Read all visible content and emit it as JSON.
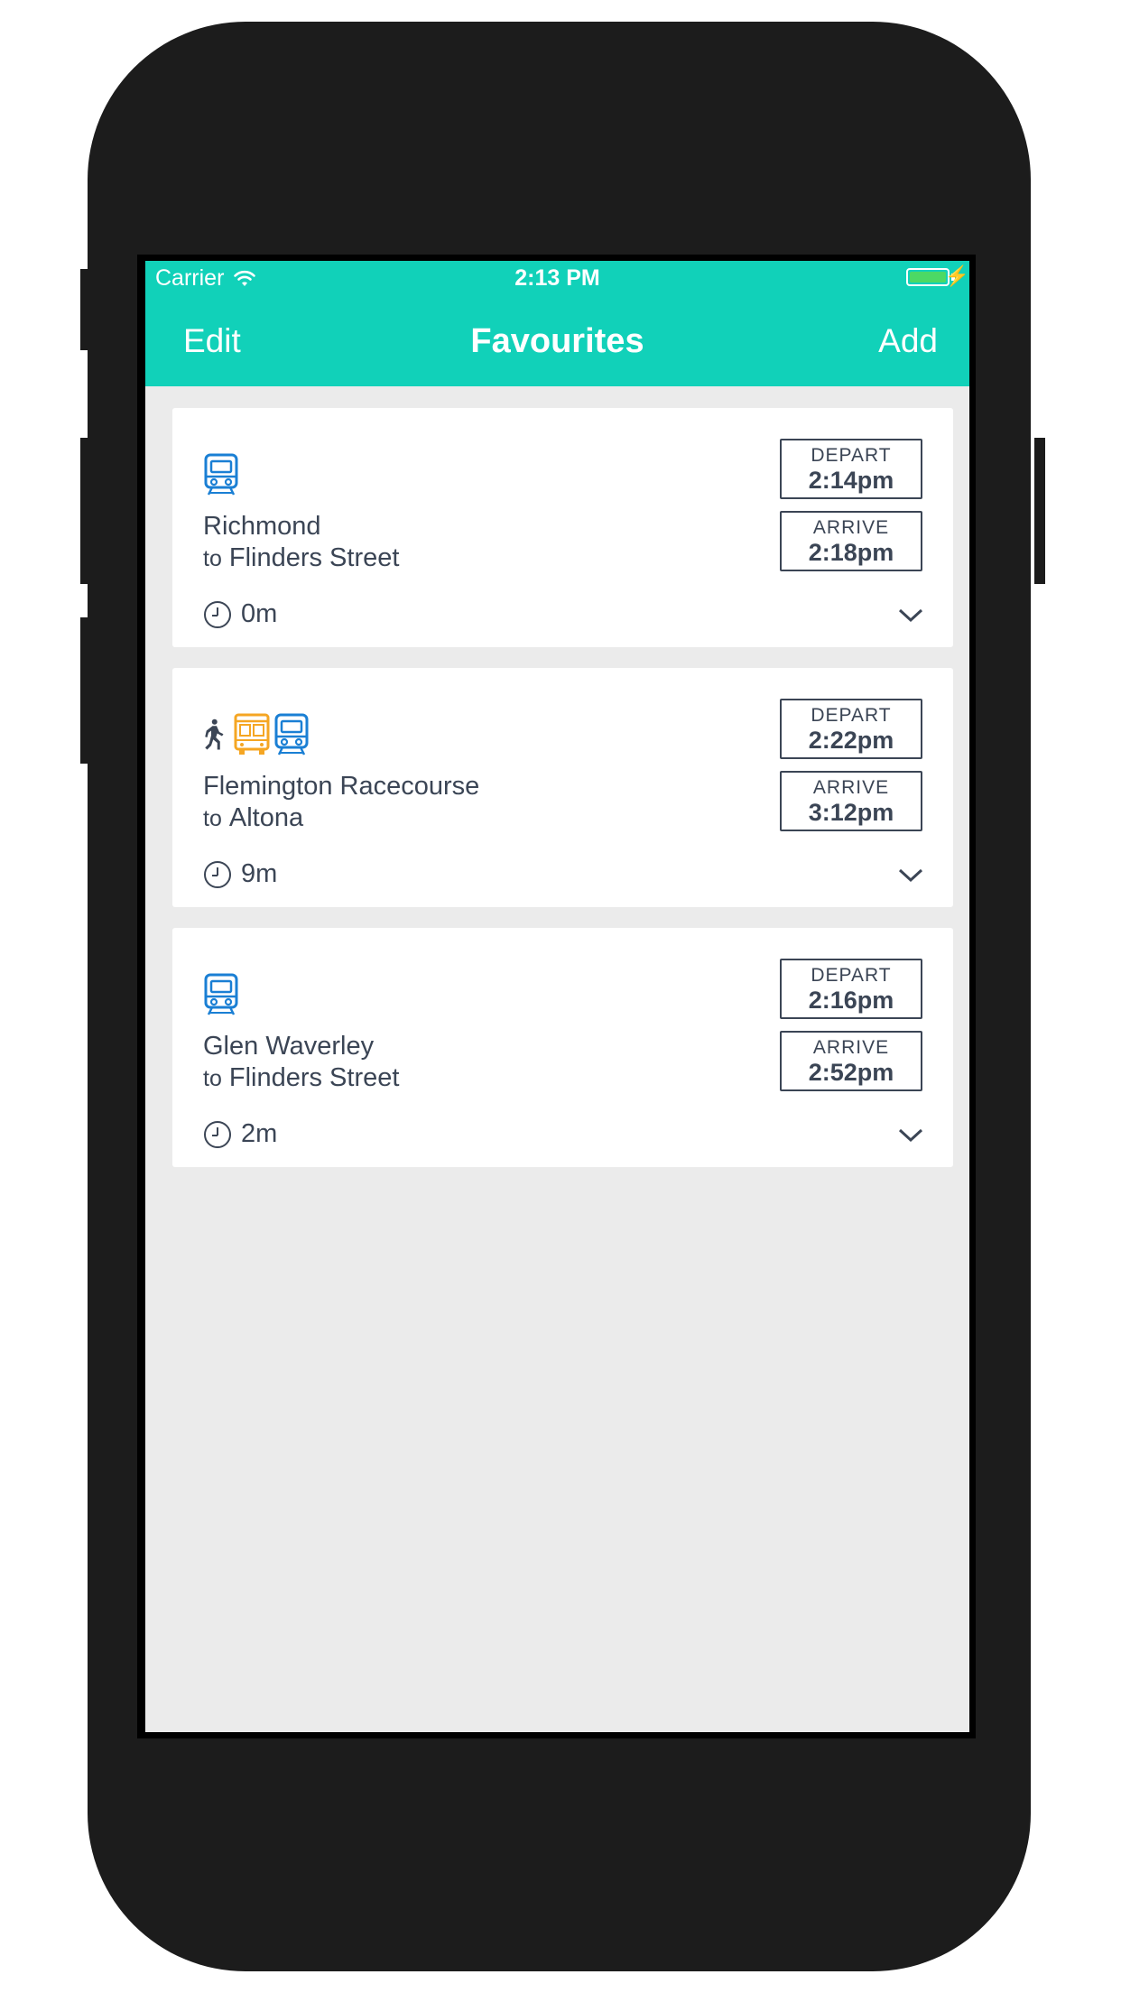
{
  "statusbar": {
    "carrier": "Carrier",
    "time": "2:13 PM",
    "battery_color": "#4cd964"
  },
  "navbar": {
    "edit_label": "Edit",
    "title": "Favourites",
    "add_label": "Add",
    "color": "#11d1b9"
  },
  "favourites": [
    {
      "modes": [
        "train-icon"
      ],
      "origin": "Richmond",
      "to_word": "to",
      "destination": "Flinders Street",
      "duration": "0m",
      "depart_label": "DEPART",
      "depart_time": "2:14pm",
      "arrive_label": "ARRIVE",
      "arrive_time": "2:18pm"
    },
    {
      "modes": [
        "walk-icon",
        "bus-icon",
        "train-icon"
      ],
      "origin": "Flemington Racecourse",
      "to_word": "to",
      "destination": "Altona",
      "duration": "9m",
      "depart_label": "DEPART",
      "depart_time": "2:22pm",
      "arrive_label": "ARRIVE",
      "arrive_time": "3:12pm"
    },
    {
      "modes": [
        "train-icon"
      ],
      "origin": "Glen Waverley",
      "to_word": "to",
      "destination": "Flinders Street",
      "duration": "2m",
      "depart_label": "DEPART",
      "depart_time": "2:16pm",
      "arrive_label": "ARRIVE",
      "arrive_time": "2:52pm"
    }
  ],
  "colors": {
    "train": "#1a7fd4",
    "bus": "#f5a623",
    "walk": "#3b4555",
    "text": "#3b4555"
  }
}
